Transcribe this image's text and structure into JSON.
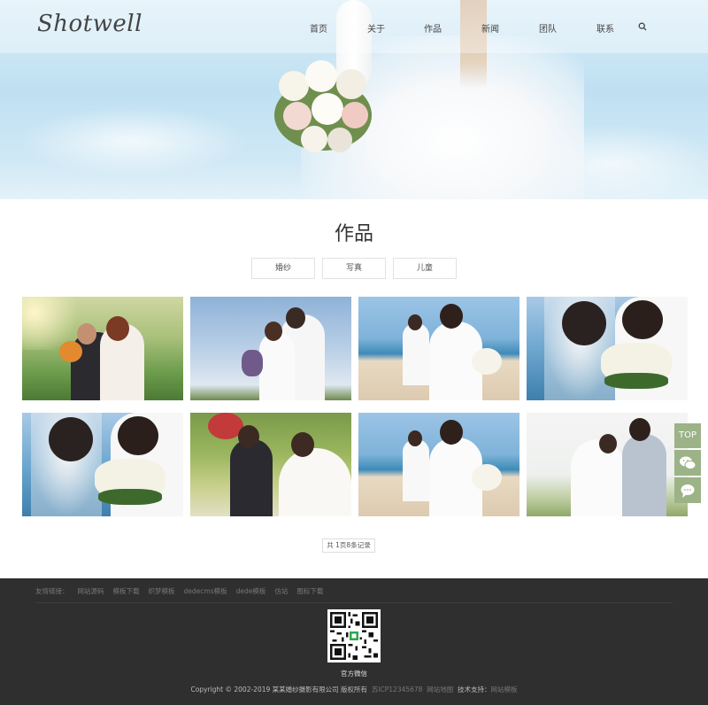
{
  "header": {
    "logo": "Shotwell",
    "nav": [
      {
        "label": "首页",
        "key": "home"
      },
      {
        "label": "关于",
        "key": "about"
      },
      {
        "label": "作品",
        "key": "works"
      },
      {
        "label": "新闻",
        "key": "news"
      },
      {
        "label": "团队",
        "key": "team"
      },
      {
        "label": "联系",
        "key": "contact"
      }
    ],
    "search_icon": "search-icon"
  },
  "section": {
    "title": "作品",
    "tabs": [
      "婚纱",
      "写真",
      "儿童"
    ]
  },
  "gallery": [
    {
      "scene": "garden-embrace"
    },
    {
      "scene": "sky-bouquet"
    },
    {
      "scene": "beach-walk"
    },
    {
      "scene": "seaside-closeup"
    },
    {
      "scene": "seaside-closeup"
    },
    {
      "scene": "garden-sitting"
    },
    {
      "scene": "beach-walk"
    },
    {
      "scene": "veil-embrace"
    }
  ],
  "pager": {
    "text": "共 1页8条记录"
  },
  "side_tools": {
    "top_label": "TOP",
    "wechat_icon": "wechat-icon",
    "message_icon": "message-icon",
    "color": "#9bb387"
  },
  "footer": {
    "links_label": "友情链接：",
    "links": [
      "网站源码",
      "模板下载",
      "织梦模板",
      "dedecms模板",
      "dede模板",
      "仿站",
      "图标下载"
    ],
    "qr_caption": "官方微信",
    "copyright": "Copyright © 2002-2019 某某婚纱摄影有限公司 版权所有",
    "icp": "苏ICP12345678",
    "sitemap": "网站地图",
    "tech_label": "技术支持：",
    "tech_value": "网站模板"
  }
}
